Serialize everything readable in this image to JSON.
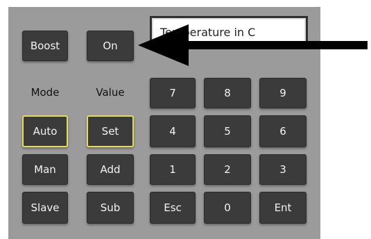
{
  "display": {
    "text": "Temperature in C"
  },
  "controls": {
    "boost": "Boost",
    "on": "On"
  },
  "labels": {
    "mode": "Mode",
    "value": "Value"
  },
  "mode_buttons": {
    "auto": "Auto",
    "man": "Man",
    "slave": "Slave"
  },
  "value_buttons": {
    "set": "Set",
    "add": "Add",
    "sub": "Sub"
  },
  "keypad": {
    "k7": "7",
    "k8": "8",
    "k9": "9",
    "k4": "4",
    "k5": "5",
    "k6": "6",
    "k1": "1",
    "k2": "2",
    "k3": "3",
    "esc": "Esc",
    "k0": "0",
    "ent": "Ent"
  },
  "colors": {
    "panel": "#9b9b9b",
    "button": "#3b3b3b",
    "selected_border": "#e2dd5a"
  },
  "annotation": {
    "arrow_icon": "arrow-left-icon"
  }
}
